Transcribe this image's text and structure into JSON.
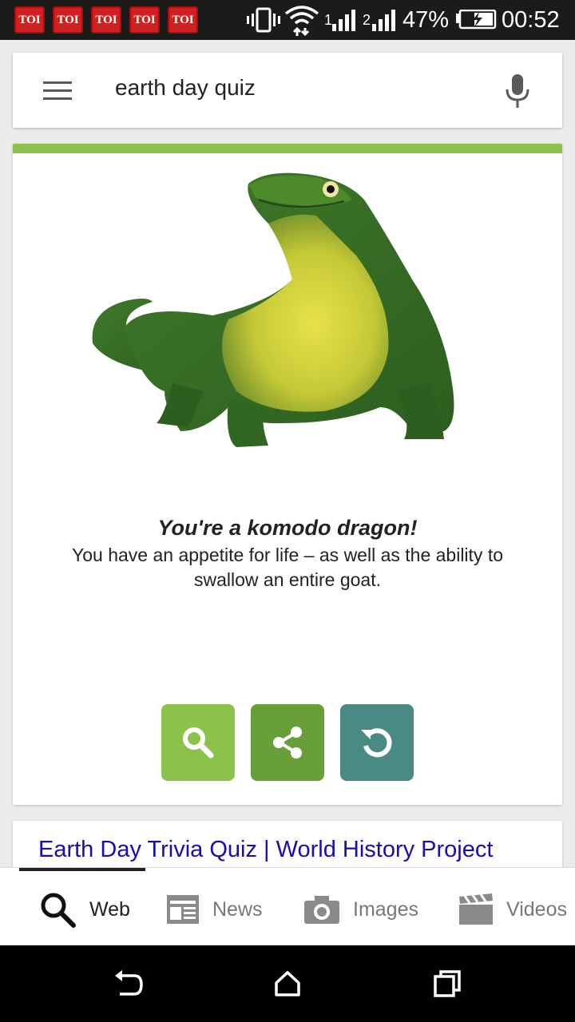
{
  "status_bar": {
    "notifications": [
      "TOI",
      "TOI",
      "TOI",
      "TOI",
      "TOI"
    ],
    "sim1_label": "1",
    "sim2_label": "2",
    "battery": "47%",
    "time": "00:52"
  },
  "search": {
    "query": "earth day quiz"
  },
  "quiz_card": {
    "accent_color": "#8bc34a",
    "result_title": "You're a komodo dragon!",
    "result_description": "You have an appetite for life – as well as the ability to swallow an entire goat.",
    "buttons": [
      {
        "icon": "search-icon",
        "color": "#8bc34a"
      },
      {
        "icon": "share-icon",
        "color": "#689f38"
      },
      {
        "icon": "replay-icon",
        "color": "#4a8a84"
      }
    ]
  },
  "next_result": {
    "title": "Earth Day Trivia Quiz | World History Project",
    "color": "#1a0dab"
  },
  "tabs": [
    {
      "label": "Web",
      "icon": "search-icon",
      "active": true
    },
    {
      "label": "News",
      "icon": "newspaper-icon",
      "active": false
    },
    {
      "label": "Images",
      "icon": "camera-icon",
      "active": false
    },
    {
      "label": "Videos",
      "icon": "clapperboard-icon",
      "active": false
    }
  ],
  "nav_bar": {
    "buttons": [
      "back-icon",
      "home-icon",
      "recents-icon"
    ]
  }
}
